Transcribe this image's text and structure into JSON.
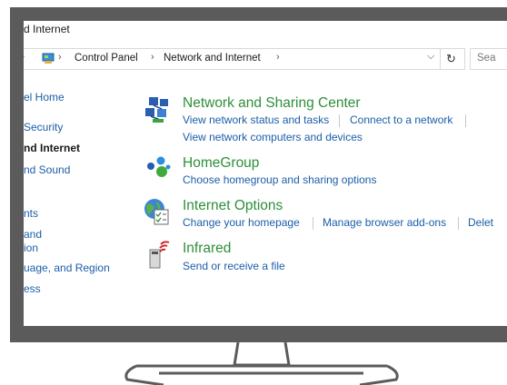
{
  "window": {
    "title": "d Internet"
  },
  "address": {
    "breadcrumbs": [
      "Control Panel",
      "Network and Internet"
    ],
    "search_placeholder": "Sea"
  },
  "sidebar": {
    "items": [
      {
        "label": "el Home"
      },
      {
        "label": "Security"
      },
      {
        "label": "nd Internet",
        "current": true
      },
      {
        "label": "nd Sound"
      },
      {
        "label": "nts"
      },
      {
        "label": "and"
      },
      {
        "label": "ion"
      },
      {
        "label": "uage, and Region"
      },
      {
        "label": "ess"
      }
    ]
  },
  "categories": [
    {
      "title": "Network and Sharing Center",
      "icon": "network-sharing-icon",
      "links": [
        "View network status and tasks",
        "Connect to a network",
        "View network computers and devices"
      ]
    },
    {
      "title": "HomeGroup",
      "icon": "homegroup-icon",
      "links": [
        "Choose homegroup and sharing options"
      ]
    },
    {
      "title": "Internet Options",
      "icon": "internet-options-icon",
      "links": [
        "Change your homepage",
        "Manage browser add-ons",
        "Delet"
      ]
    },
    {
      "title": "Infrared",
      "icon": "infrared-icon",
      "links": [
        "Send or receive a file"
      ]
    }
  ],
  "colors": {
    "bezel": "#5b5b5b",
    "category_title": "#2f8f3a",
    "link": "#1b5ea8"
  }
}
